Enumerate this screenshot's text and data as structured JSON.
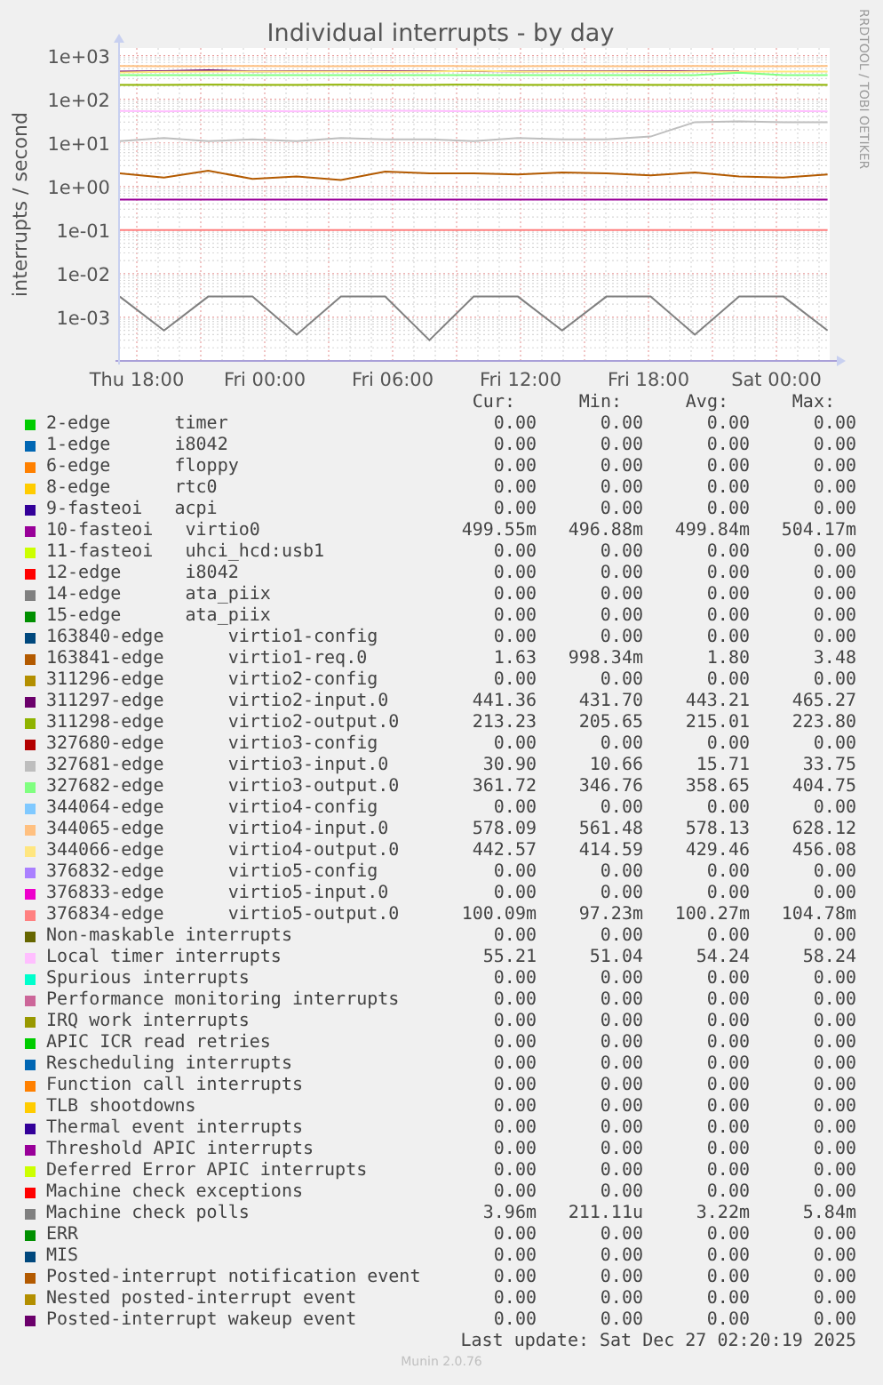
{
  "chart": {
    "title": "Individual interrupts - by day",
    "ylabel": "interrupts / second",
    "x_labels": [
      "Thu 18:00",
      "Fri 00:00",
      "Fri 06:00",
      "Fri 12:00",
      "Fri 18:00",
      "Sat 00:00"
    ],
    "y_labels": [
      "1e+03",
      "1e+02",
      "1e+01",
      "1e+00",
      "1e-01",
      "1e-02",
      "1e-03"
    ]
  },
  "credit": "RRDTOOL / TOBI OETIKER",
  "legend": {
    "columns": [
      "Cur:",
      "Min:",
      "Avg:",
      "Max:"
    ],
    "rows": [
      {
        "name": "2-edge      timer",
        "color": "#00cc00",
        "cur": "0.00",
        "min": "0.00",
        "avg": "0.00",
        "max": "0.00"
      },
      {
        "name": "1-edge      i8042",
        "color": "#0066b3",
        "cur": "0.00",
        "min": "0.00",
        "avg": "0.00",
        "max": "0.00"
      },
      {
        "name": "6-edge      floppy",
        "color": "#ff8000",
        "cur": "0.00",
        "min": "0.00",
        "avg": "0.00",
        "max": "0.00"
      },
      {
        "name": "8-edge      rtc0",
        "color": "#ffcc00",
        "cur": "0.00",
        "min": "0.00",
        "avg": "0.00",
        "max": "0.00"
      },
      {
        "name": "9-fasteoi   acpi",
        "color": "#330099",
        "cur": "0.00",
        "min": "0.00",
        "avg": "0.00",
        "max": "0.00"
      },
      {
        "name": "10-fasteoi   virtio0",
        "color": "#990099",
        "cur": "499.55m",
        "min": "496.88m",
        "avg": "499.84m",
        "max": "504.17m"
      },
      {
        "name": "11-fasteoi   uhci_hcd:usb1",
        "color": "#ccff00",
        "cur": "0.00",
        "min": "0.00",
        "avg": "0.00",
        "max": "0.00"
      },
      {
        "name": "12-edge      i8042",
        "color": "#ff0000",
        "cur": "0.00",
        "min": "0.00",
        "avg": "0.00",
        "max": "0.00"
      },
      {
        "name": "14-edge      ata_piix",
        "color": "#808080",
        "cur": "0.00",
        "min": "0.00",
        "avg": "0.00",
        "max": "0.00"
      },
      {
        "name": "15-edge      ata_piix",
        "color": "#008f00",
        "cur": "0.00",
        "min": "0.00",
        "avg": "0.00",
        "max": "0.00"
      },
      {
        "name": "163840-edge      virtio1-config",
        "color": "#00487d",
        "cur": "0.00",
        "min": "0.00",
        "avg": "0.00",
        "max": "0.00"
      },
      {
        "name": "163841-edge      virtio1-req.0",
        "color": "#b35a00",
        "cur": "1.63",
        "min": "998.34m",
        "avg": "1.80",
        "max": "3.48"
      },
      {
        "name": "311296-edge      virtio2-config",
        "color": "#b38f00",
        "cur": "0.00",
        "min": "0.00",
        "avg": "0.00",
        "max": "0.00"
      },
      {
        "name": "311297-edge      virtio2-input.0",
        "color": "#6b006b",
        "cur": "441.36",
        "min": "431.70",
        "avg": "443.21",
        "max": "465.27"
      },
      {
        "name": "311298-edge      virtio2-output.0",
        "color": "#8fb300",
        "cur": "213.23",
        "min": "205.65",
        "avg": "215.01",
        "max": "223.80"
      },
      {
        "name": "327680-edge      virtio3-config",
        "color": "#b30000",
        "cur": "0.00",
        "min": "0.00",
        "avg": "0.00",
        "max": "0.00"
      },
      {
        "name": "327681-edge      virtio3-input.0",
        "color": "#bebebe",
        "cur": "30.90",
        "min": "10.66",
        "avg": "15.71",
        "max": "33.75"
      },
      {
        "name": "327682-edge      virtio3-output.0",
        "color": "#80ff80",
        "cur": "361.72",
        "min": "346.76",
        "avg": "358.65",
        "max": "404.75"
      },
      {
        "name": "344064-edge      virtio4-config",
        "color": "#80c9ff",
        "cur": "0.00",
        "min": "0.00",
        "avg": "0.00",
        "max": "0.00"
      },
      {
        "name": "344065-edge      virtio4-input.0",
        "color": "#ffc080",
        "cur": "578.09",
        "min": "561.48",
        "avg": "578.13",
        "max": "628.12"
      },
      {
        "name": "344066-edge      virtio4-output.0",
        "color": "#ffe680",
        "cur": "442.57",
        "min": "414.59",
        "avg": "429.46",
        "max": "456.08"
      },
      {
        "name": "376832-edge      virtio5-config",
        "color": "#aa80ff",
        "cur": "0.00",
        "min": "0.00",
        "avg": "0.00",
        "max": "0.00"
      },
      {
        "name": "376833-edge      virtio5-input.0",
        "color": "#ee00cc",
        "cur": "0.00",
        "min": "0.00",
        "avg": "0.00",
        "max": "0.00"
      },
      {
        "name": "376834-edge      virtio5-output.0",
        "color": "#ff8080",
        "cur": "100.09m",
        "min": "97.23m",
        "avg": "100.27m",
        "max": "104.78m"
      },
      {
        "name": "Non-maskable interrupts",
        "color": "#666600",
        "cur": "0.00",
        "min": "0.00",
        "avg": "0.00",
        "max": "0.00"
      },
      {
        "name": "Local timer interrupts",
        "color": "#ffbfff",
        "cur": "55.21",
        "min": "51.04",
        "avg": "54.24",
        "max": "58.24"
      },
      {
        "name": "Spurious interrupts",
        "color": "#00ffcc",
        "cur": "0.00",
        "min": "0.00",
        "avg": "0.00",
        "max": "0.00"
      },
      {
        "name": "Performance monitoring interrupts",
        "color": "#cc6699",
        "cur": "0.00",
        "min": "0.00",
        "avg": "0.00",
        "max": "0.00"
      },
      {
        "name": "IRQ work interrupts",
        "color": "#999900",
        "cur": "0.00",
        "min": "0.00",
        "avg": "0.00",
        "max": "0.00"
      },
      {
        "name": "APIC ICR read retries",
        "color": "#00cc00",
        "cur": "0.00",
        "min": "0.00",
        "avg": "0.00",
        "max": "0.00"
      },
      {
        "name": "Rescheduling interrupts",
        "color": "#0066b3",
        "cur": "0.00",
        "min": "0.00",
        "avg": "0.00",
        "max": "0.00"
      },
      {
        "name": "Function call interrupts",
        "color": "#ff8000",
        "cur": "0.00",
        "min": "0.00",
        "avg": "0.00",
        "max": "0.00"
      },
      {
        "name": "TLB shootdowns",
        "color": "#ffcc00",
        "cur": "0.00",
        "min": "0.00",
        "avg": "0.00",
        "max": "0.00"
      },
      {
        "name": "Thermal event interrupts",
        "color": "#330099",
        "cur": "0.00",
        "min": "0.00",
        "avg": "0.00",
        "max": "0.00"
      },
      {
        "name": "Threshold APIC interrupts",
        "color": "#990099",
        "cur": "0.00",
        "min": "0.00",
        "avg": "0.00",
        "max": "0.00"
      },
      {
        "name": "Deferred Error APIC interrupts",
        "color": "#ccff00",
        "cur": "0.00",
        "min": "0.00",
        "avg": "0.00",
        "max": "0.00"
      },
      {
        "name": "Machine check exceptions",
        "color": "#ff0000",
        "cur": "0.00",
        "min": "0.00",
        "avg": "0.00",
        "max": "0.00"
      },
      {
        "name": "Machine check polls",
        "color": "#808080",
        "cur": "3.96m",
        "min": "211.11u",
        "avg": "3.22m",
        "max": "5.84m"
      },
      {
        "name": "ERR",
        "color": "#008f00",
        "cur": "0.00",
        "min": "0.00",
        "avg": "0.00",
        "max": "0.00"
      },
      {
        "name": "MIS",
        "color": "#00487d",
        "cur": "0.00",
        "min": "0.00",
        "avg": "0.00",
        "max": "0.00"
      },
      {
        "name": "Posted-interrupt notification event",
        "color": "#b35a00",
        "cur": "0.00",
        "min": "0.00",
        "avg": "0.00",
        "max": "0.00"
      },
      {
        "name": "Nested posted-interrupt event",
        "color": "#b38f00",
        "cur": "0.00",
        "min": "0.00",
        "avg": "0.00",
        "max": "0.00"
      },
      {
        "name": "Posted-interrupt wakeup event",
        "color": "#6b006b",
        "cur": "0.00",
        "min": "0.00",
        "avg": "0.00",
        "max": "0.00"
      }
    ]
  },
  "last_update": "Last update: Sat Dec 27 02:20:19 2025",
  "footer": "Munin 2.0.76"
}
